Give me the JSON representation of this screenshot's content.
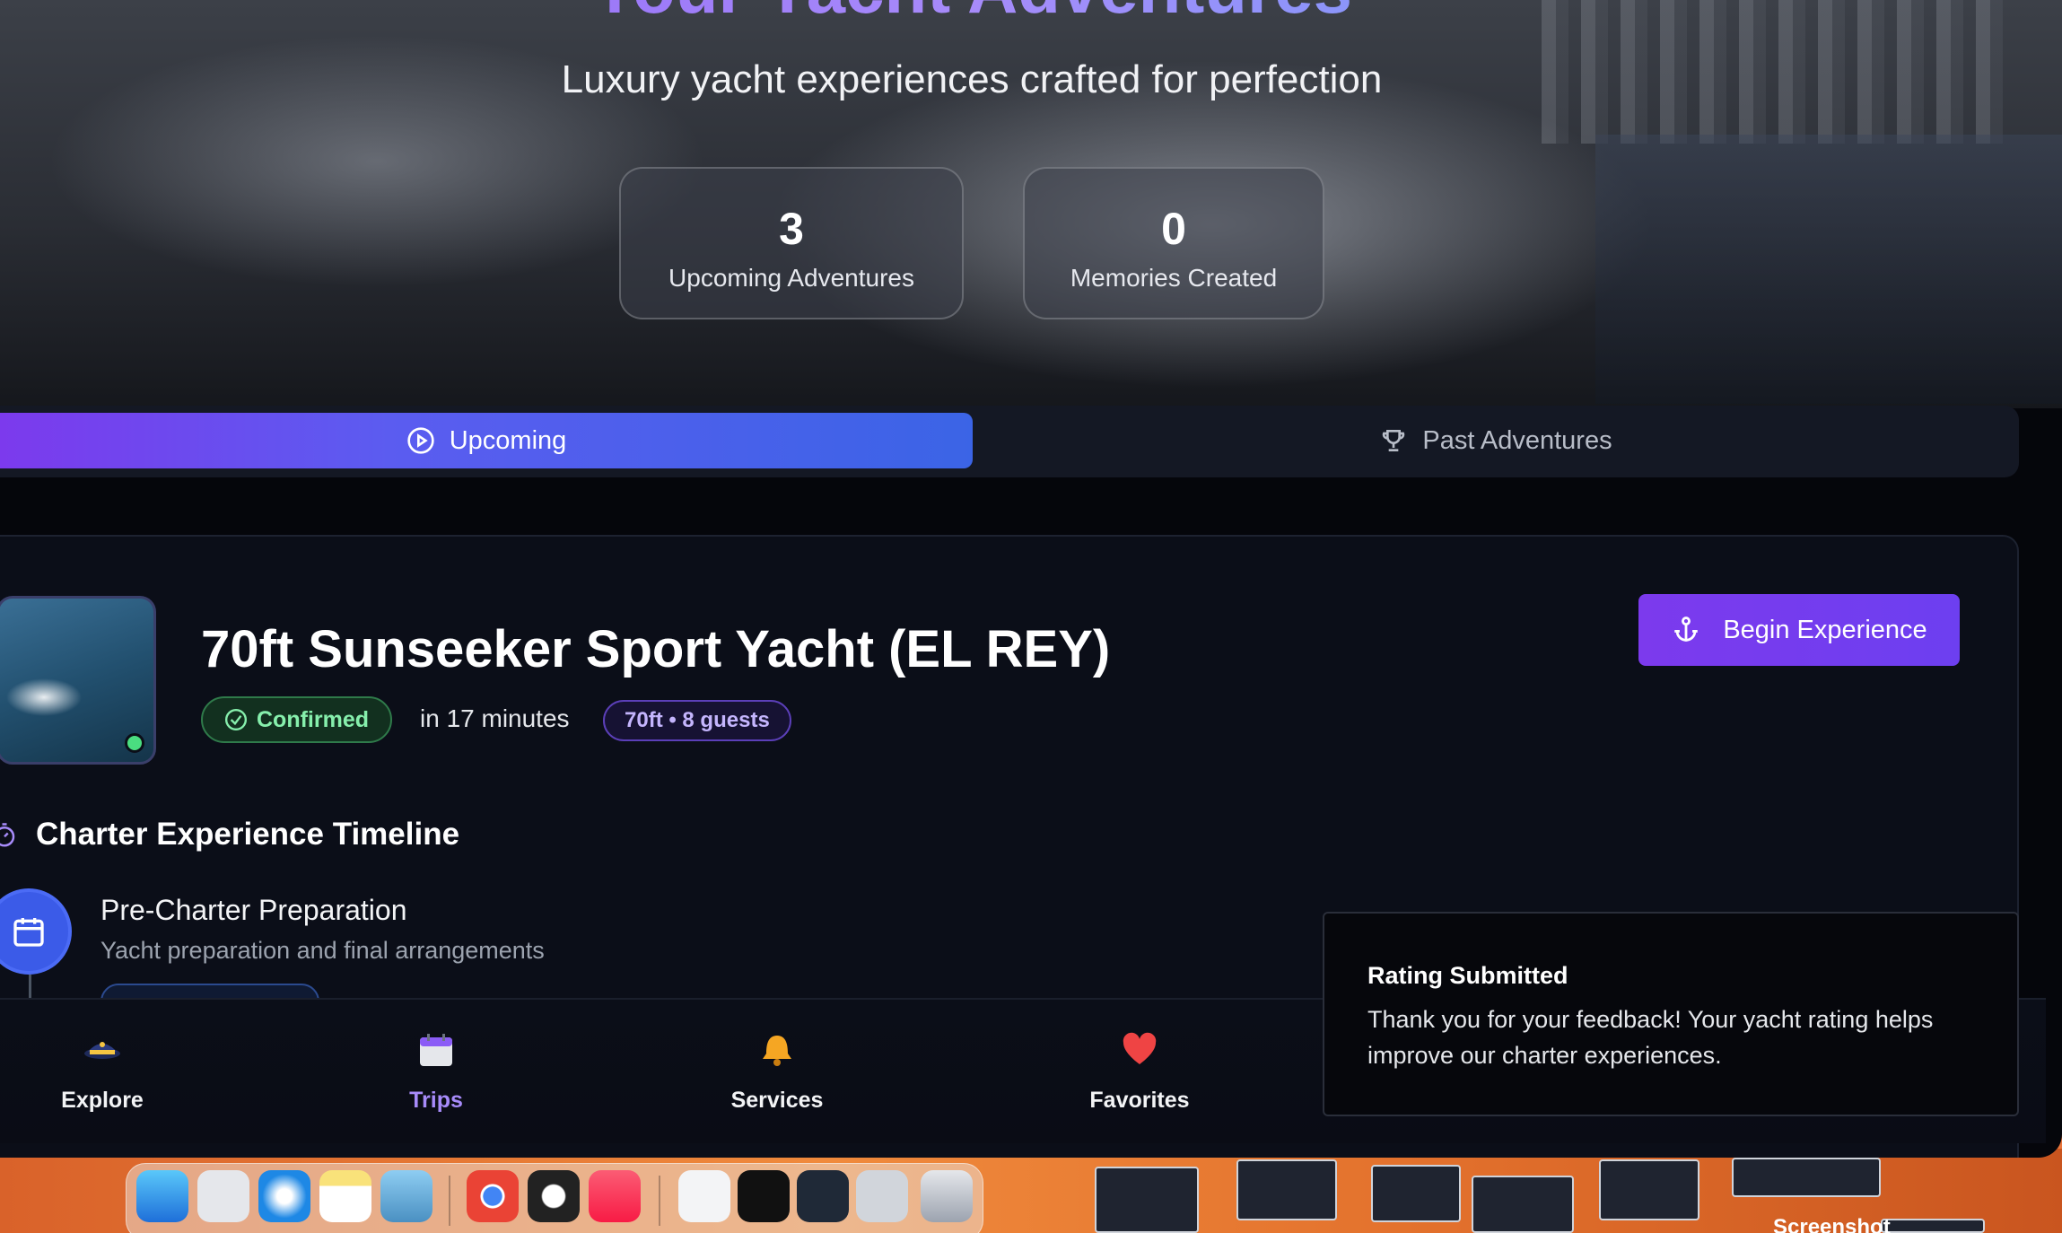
{
  "hero": {
    "title": "Your Yacht Adventures",
    "subtitle": "Luxury yacht experiences crafted for perfection",
    "stats": [
      {
        "value": "3",
        "label": "Upcoming Adventures"
      },
      {
        "value": "0",
        "label": "Memories Created"
      }
    ]
  },
  "tabs": [
    {
      "label": "Upcoming",
      "icon": "play-circle-icon",
      "active": true
    },
    {
      "label": "Past Adventures",
      "icon": "trophy-icon",
      "active": false
    }
  ],
  "trip": {
    "title": "70ft Sunseeker Sport Yacht (EL REY)",
    "status": "Confirmed",
    "countdown": "in 17 minutes",
    "spec": "70ft • 8 guests",
    "action_label": "Begin Experience",
    "status_color": "#4ade80"
  },
  "timeline": {
    "title": "Charter Experience Timeline",
    "steps": [
      {
        "title": "Pre-Charter Preparation",
        "description": "Yacht preparation and final arrangements",
        "icon": "calendar-icon"
      }
    ]
  },
  "bottom_nav": [
    {
      "label": "Explore",
      "icon": "captain-hat-icon",
      "active": false
    },
    {
      "label": "Trips",
      "icon": "calendar-icon",
      "active": true
    },
    {
      "label": "Services",
      "icon": "bell-icon",
      "active": false
    },
    {
      "label": "Favorites",
      "icon": "heart-icon",
      "active": false
    }
  ],
  "toast": {
    "title": "Rating Submitted",
    "message": "Thank you for your feedback! Your yacht rating helps improve our charter experiences."
  },
  "desktop": {
    "screenshot_label": "Screenshot"
  },
  "colors": {
    "accent": "#7c3aed",
    "accent_blue": "#3b64e6",
    "success": "#4ade80"
  }
}
